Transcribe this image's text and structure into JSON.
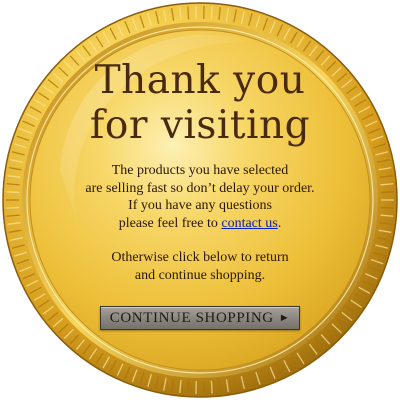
{
  "headline": {
    "line1": "Thank you",
    "line2": "for visiting"
  },
  "message": {
    "line1": "The products you have selected",
    "line2": "are selling fast so don’t delay your order.",
    "line3": "If you have any questions",
    "line4_before_link": "please feel free to ",
    "link_text": "contact us",
    "line4_after_link": "."
  },
  "message2": {
    "line1": "Otherwise click below to return",
    "line2": "and continue shopping."
  },
  "continue_button": {
    "label": "CONTINUE SHOPPING",
    "arrow_icon": "right-triangle-arrow-icon"
  },
  "colors": {
    "gold_light": "#fbe9a0",
    "gold_mid": "#f0c43a",
    "gold_dark": "#b07d12",
    "headline_text": "#4a2a0e",
    "link": "#0b20b8",
    "button_gray": "#8e8982"
  }
}
